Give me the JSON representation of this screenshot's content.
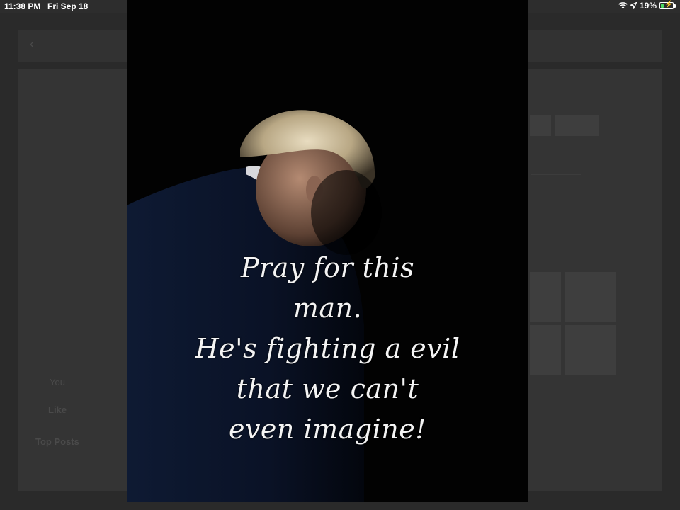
{
  "status_bar": {
    "time": "11:38 PM",
    "date": "Fri Sep 18",
    "battery_percent": "19%",
    "wifi_icon": "wifi-icon",
    "location_icon": "location-arrow-icon",
    "battery_icon": "battery-charging-icon"
  },
  "background": {
    "reaction_label": "You",
    "like_label": "Like",
    "section_title": "Top Posts"
  },
  "photo": {
    "caption_lines": [
      "Pray for this",
      "man.",
      "He's fighting a evil",
      "that we can't",
      "even imagine!"
    ]
  },
  "colors": {
    "photo_background": "#020202",
    "caption_text": "#f4f4f4",
    "dim_background": "#2a2a2a"
  }
}
